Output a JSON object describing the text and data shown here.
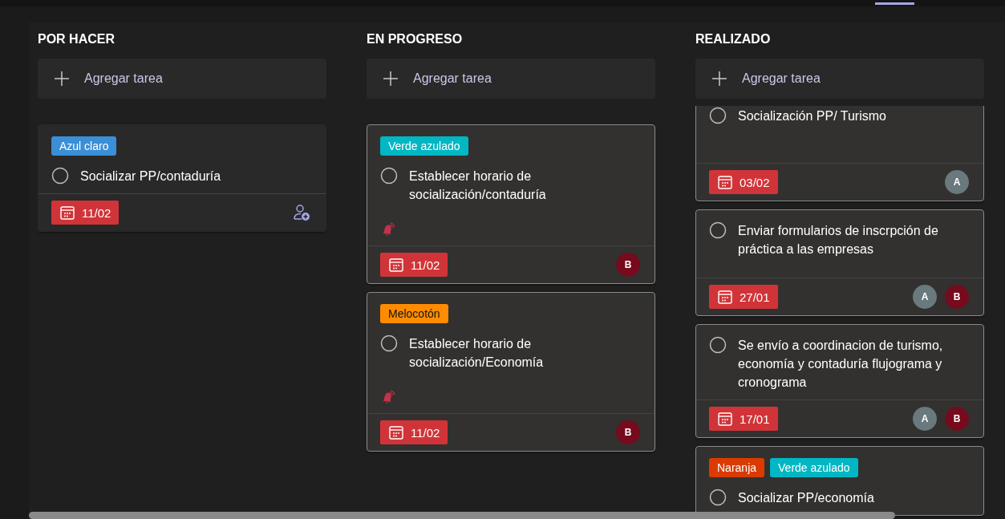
{
  "columns": [
    {
      "name": "POR HACER",
      "add_label": "Agregar tarea",
      "scrolled": false,
      "cards": [
        {
          "labels": [
            {
              "text": "Azul claro",
              "color": "#3a8fd6"
            }
          ],
          "title": "Socializar PP/contaduría",
          "done": false,
          "reminder": false,
          "due": "11/02",
          "bordered": false
        }
      ]
    },
    {
      "name": "EN PROGRESO",
      "add_label": "Agregar tarea",
      "scrolled": false,
      "cards": [
        {
          "labels": [
            {
              "text": "Verde azulado",
              "color": "#00b7c3"
            }
          ],
          "title": "Establecer horario de socialización/contaduría",
          "done": false,
          "reminder": true,
          "due": "11/02",
          "assignees": [
            {
              "initial": "B",
              "color": "#750b1c"
            }
          ],
          "bordered": true
        },
        {
          "labels": [
            {
              "text": "Melocotón",
              "color": "#ff8c00"
            }
          ],
          "title": "Establecer horario de socialización/Economía",
          "done": false,
          "reminder": true,
          "due": "11/02",
          "assignees": [
            {
              "initial": "B",
              "color": "#750b1c"
            }
          ],
          "bordered": true
        }
      ]
    },
    {
      "name": "REALIZADO",
      "add_label": "Agregar tarea",
      "scrolled": true,
      "cards": [
        {
          "title": "Socialización PP/ Turismo",
          "done": false,
          "reminder": false,
          "due": "03/02",
          "assignees": [
            {
              "initial": "A",
              "color": "#69797e"
            }
          ],
          "bordered": true
        },
        {
          "title": "Enviar formularios de inscrpción de práctica a las empresas",
          "done": false,
          "reminder": false,
          "due": "27/01",
          "assignees": [
            {
              "initial": "A",
              "color": "#69797e"
            },
            {
              "initial": "B",
              "color": "#750b1c"
            }
          ],
          "bordered": true
        },
        {
          "title": "Se envío a coordinacion de turismo, economía y contaduría flujograma y cronograma",
          "done": false,
          "reminder": false,
          "due": "17/01",
          "assignees": [
            {
              "initial": "A",
              "color": "#69797e"
            },
            {
              "initial": "B",
              "color": "#750b1c"
            }
          ],
          "bordered": true
        },
        {
          "labels": [
            {
              "text": "Naranja",
              "color": "#da3b01"
            },
            {
              "text": "Verde azulado",
              "color": "#00b7c3"
            }
          ],
          "title": "Socializar PP/economía",
          "done": false,
          "reminder": false,
          "bordered": true
        }
      ]
    }
  ]
}
